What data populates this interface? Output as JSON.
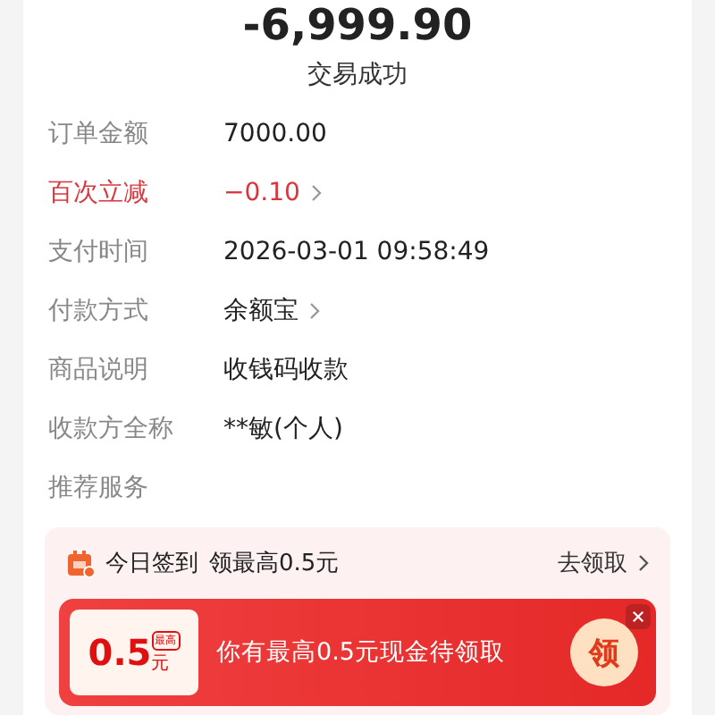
{
  "amount": "-6,999.90",
  "status": "交易成功",
  "details": [
    {
      "label": "订单金额",
      "value": "7000.00",
      "highlight": false,
      "chevron": false
    },
    {
      "label": "百次立减",
      "value": "−0.10",
      "highlight": true,
      "chevron": true
    },
    {
      "label": "支付时间",
      "value": "2026-03-01 09:58:49",
      "highlight": false,
      "chevron": false
    },
    {
      "label": "付款方式",
      "value": "余额宝",
      "highlight": false,
      "chevron": true
    },
    {
      "label": "商品说明",
      "value": "收钱码收款",
      "highlight": false,
      "chevron": false
    },
    {
      "label": "收款方全称",
      "value": "**敏(个人)",
      "highlight": false,
      "chevron": false
    }
  ],
  "section_title": "推荐服务",
  "promo": {
    "title": "今日签到",
    "subtitle": "领最高0.5元",
    "action": "去领取",
    "coupon_amount": "0.5",
    "coupon_tag": "最高",
    "coupon_unit": "元",
    "message": "你有最高0.5元现金待领取",
    "claim": "领"
  }
}
